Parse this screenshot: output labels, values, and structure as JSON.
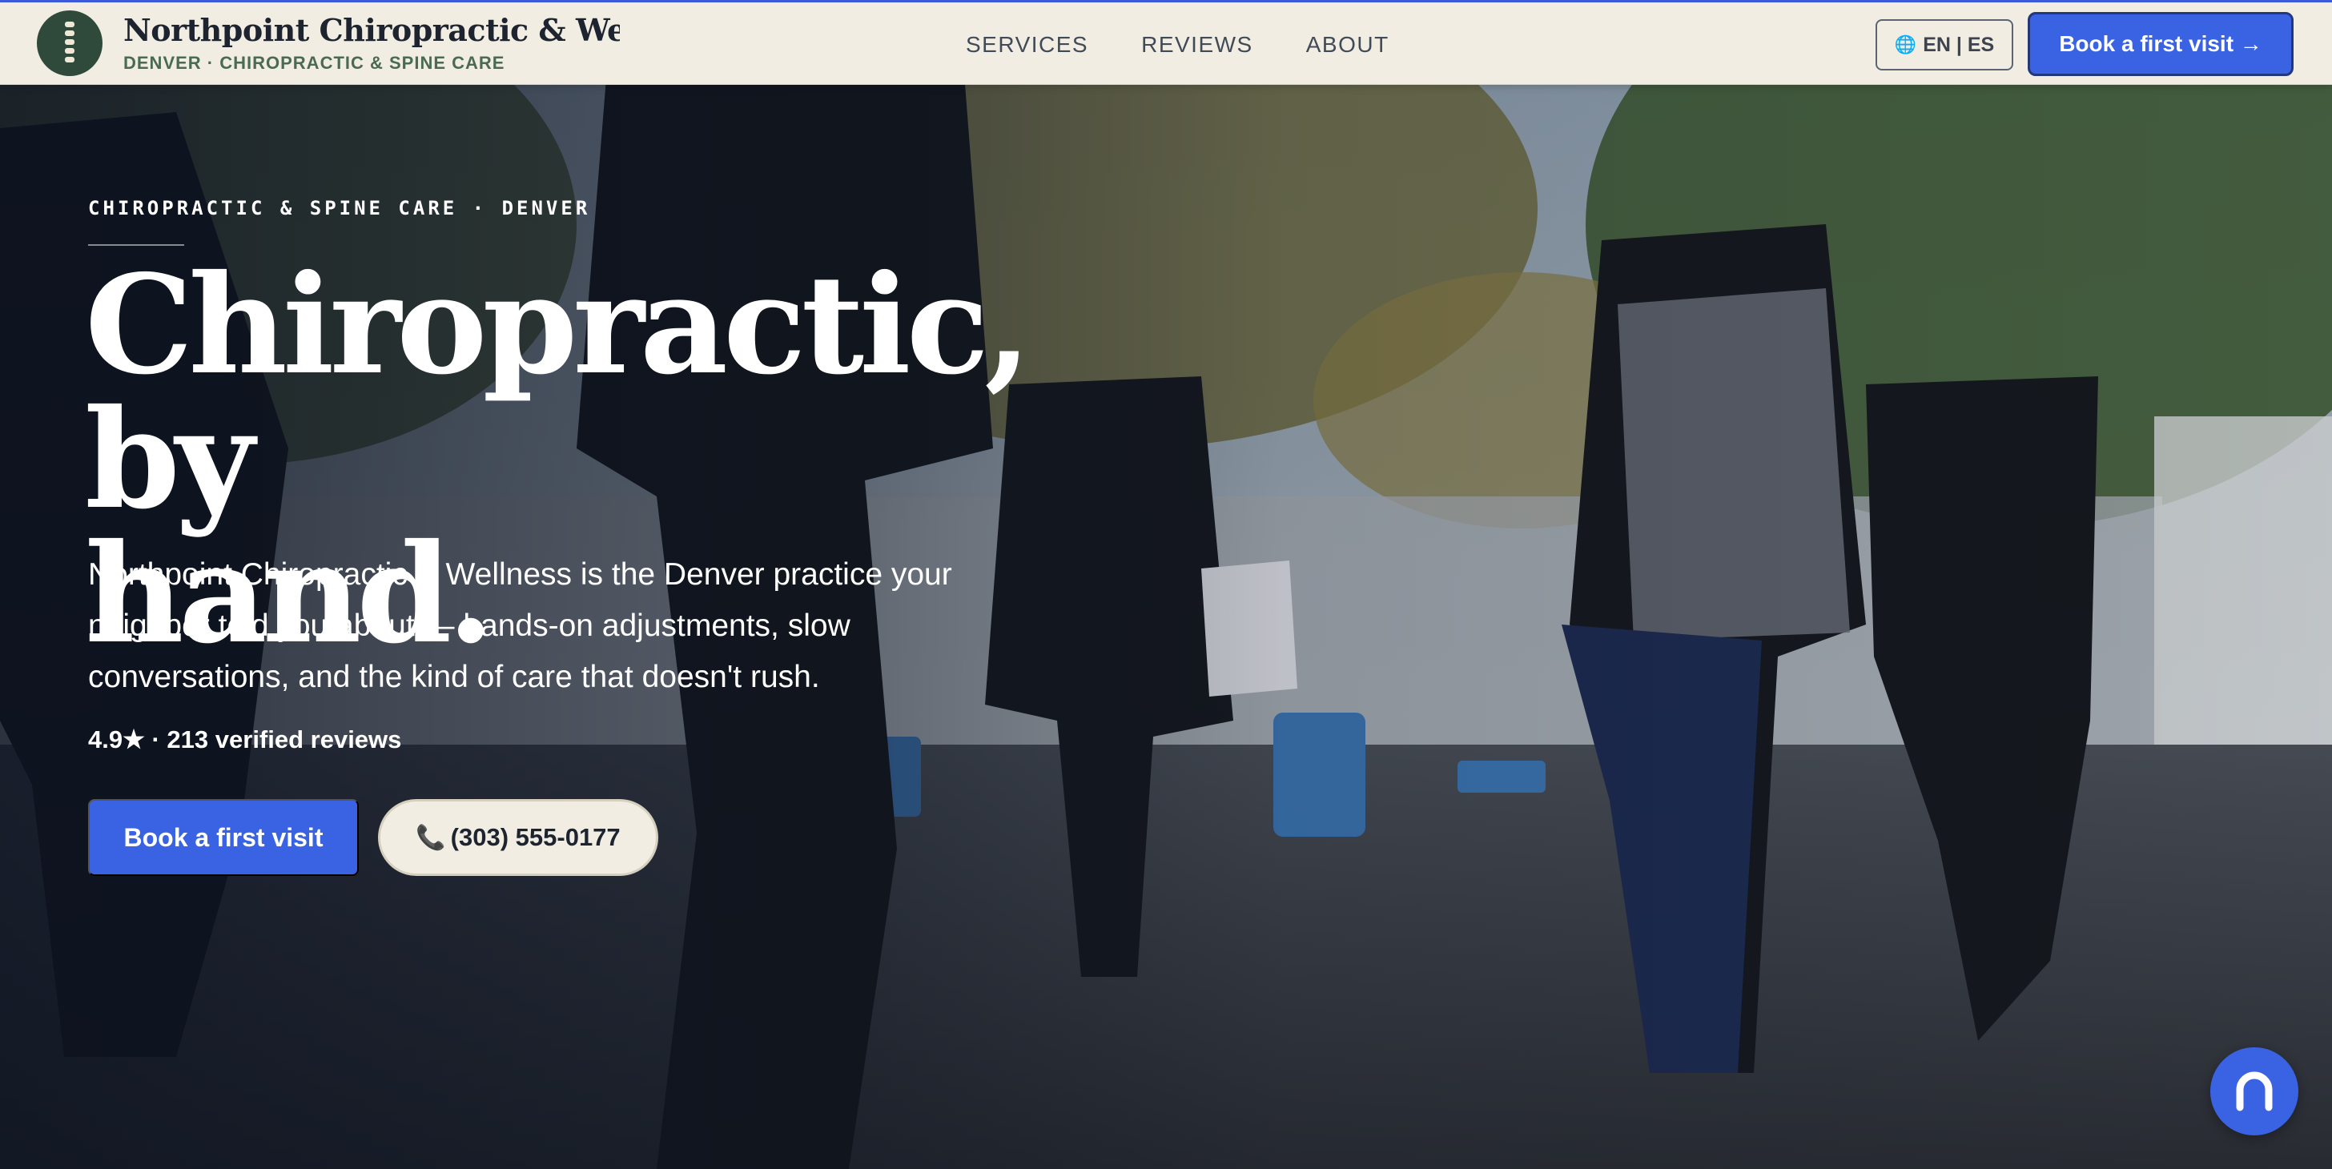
{
  "brand": {
    "name": "Northpoint Chiropractic & Wellne",
    "tagline": "DENVER · CHIROPRACTIC & SPINE CARE",
    "logo_icon": "spine-icon"
  },
  "nav": {
    "links": [
      {
        "label": "SERVICES"
      },
      {
        "label": "REVIEWS"
      },
      {
        "label": "ABOUT"
      }
    ],
    "language_toggle": "EN | ES",
    "language_icon": "globe-icon",
    "cta_label": "Book a first visit →"
  },
  "hero": {
    "eyebrow": "CHIROPRACTIC & SPINE CARE · DENVER",
    "headline_line1": "Chiropractic, by",
    "headline_line2": "hand.",
    "lede": "Northpoint Chiropractic & Wellness is the Denver practice your neighbor told you about — hands-on adjustments, slow conversations, and the kind of care that doesn't rush.",
    "rating": "4.9★ · 213 verified reviews",
    "primary_button": "Book a first visit",
    "phone_button": "(303) 555-0177",
    "phone_icon": "phone-icon"
  },
  "chat": {
    "icon": "chat-bubble-icon"
  },
  "colors": {
    "accent": "#3a63e4",
    "nav_background": "#f1ede2",
    "logo_green": "#2f4a3a"
  }
}
